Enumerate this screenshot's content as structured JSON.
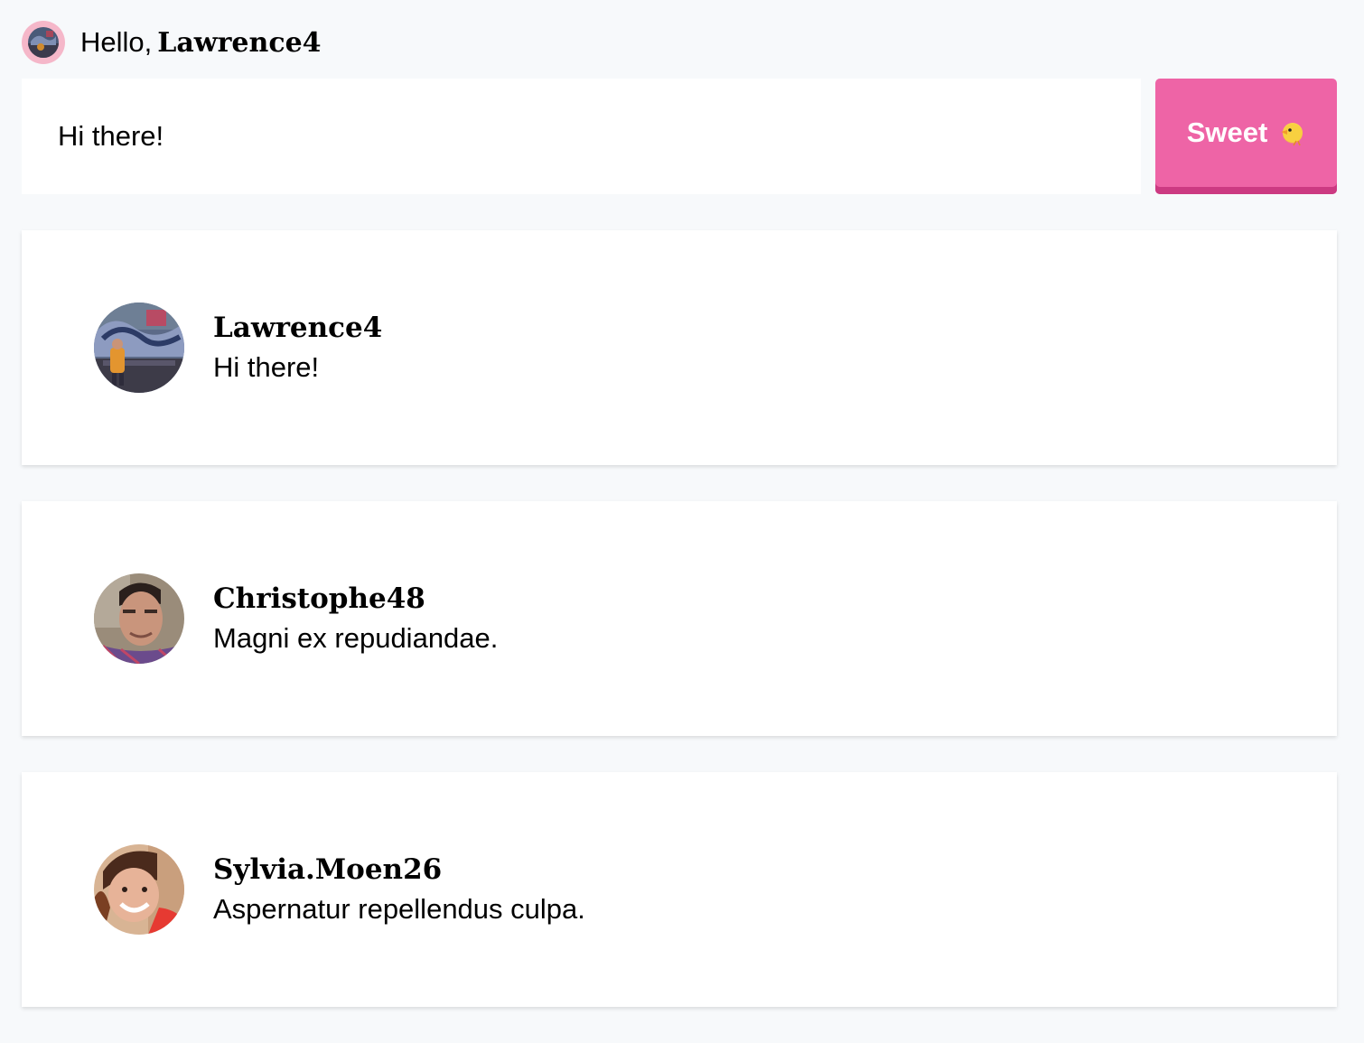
{
  "header": {
    "greeting_prefix": "Hello,",
    "username": "Lawrence4",
    "avatar_icon": "user-avatar"
  },
  "composer": {
    "value": "Hi there!",
    "placeholder": ""
  },
  "send_button": {
    "label": "Sweet",
    "icon": "chick-icon",
    "color": "#ee64a6"
  },
  "feed": [
    {
      "author": "Lawrence4",
      "message": "Hi there!",
      "avatar_icon": "graffiti-photo"
    },
    {
      "author": "Christophe48",
      "message": "Magni ex repudiandae.",
      "avatar_icon": "man-photo"
    },
    {
      "author": "Sylvia.Moen26",
      "message": "Aspernatur repellendus culpa.",
      "avatar_icon": "woman-photo"
    }
  ]
}
